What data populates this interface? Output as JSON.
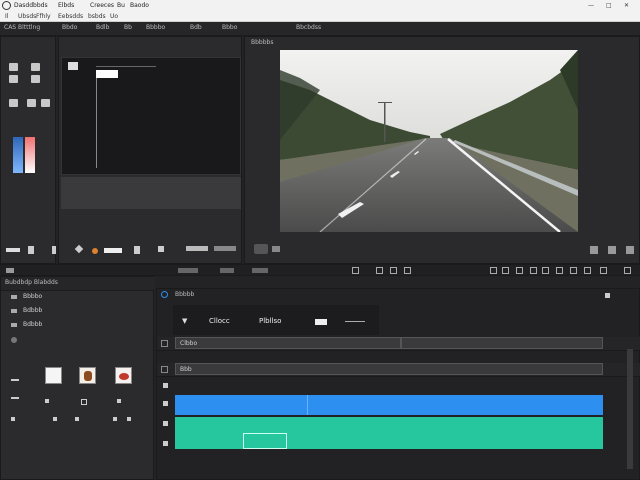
{
  "menubar": {
    "items": [
      "Dasddbbds",
      "Elbds",
      "Creeces",
      "Bu",
      "Baodo"
    ],
    "submenu": [
      "Il",
      "Ubsds",
      "Ffhly",
      "Eebsdds",
      "bsbds",
      "Uo"
    ],
    "window_controls": [
      "—",
      "□",
      "✕"
    ]
  },
  "source_panel": {
    "tabs": [
      "CAS Bltttlng",
      "Bbdo",
      "Bdlb",
      "Bb",
      "Bbbbo",
      "Bdb",
      "Bbbo",
      "Bbcbdss"
    ]
  },
  "program_panel": {
    "tab_label": "Bbbbbs"
  },
  "timeline": {
    "project_label": "Bubdbdp Blabdds",
    "sequence_label": "Bbbbb",
    "header_text_1": "Cllocc",
    "header_text_2": "Plbllso",
    "track_top_label": "Clbbo",
    "track_2_label": "Bbb",
    "project_items": [
      "Bbbbo",
      "Bdbbb",
      "Bdbbb"
    ]
  },
  "colors": {
    "accent_blue": "#2d8ff0",
    "accent_green": "#26c79e",
    "bg_dark": "#232325",
    "panel": "#2b2b2d"
  },
  "icons": [
    "app-logo-icon",
    "play-icon",
    "film-icon",
    "scissors-icon",
    "zoom-icon"
  ]
}
